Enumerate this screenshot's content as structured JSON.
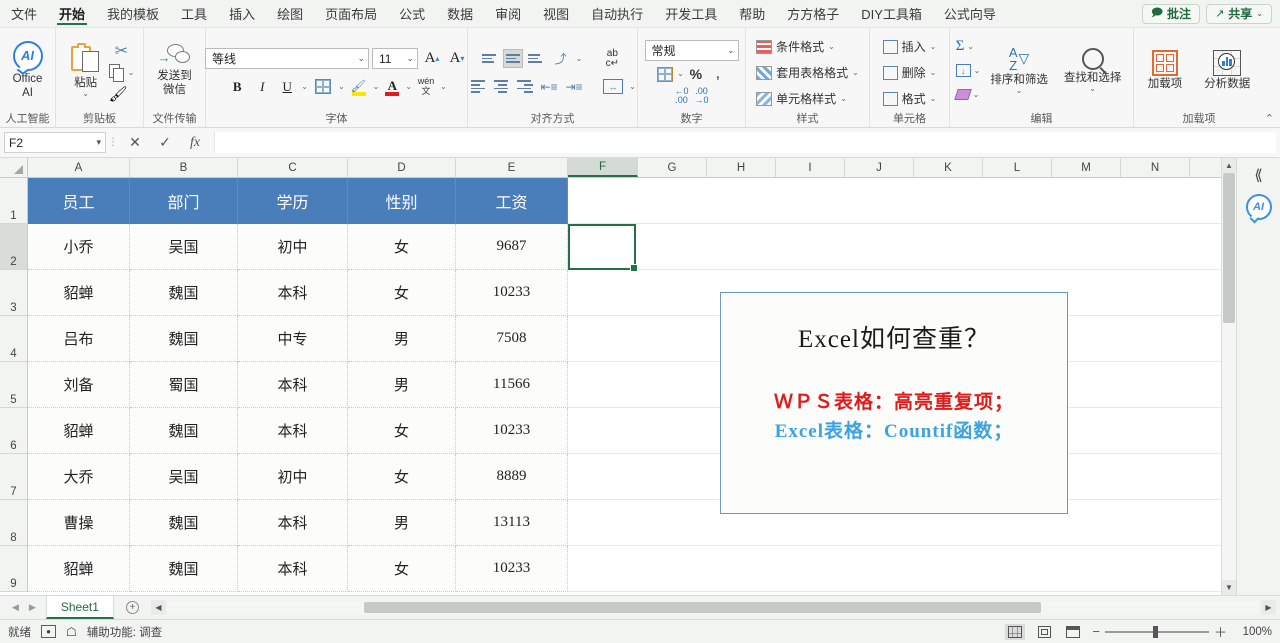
{
  "menu": {
    "tabs": [
      {
        "label": "文件",
        "active": false
      },
      {
        "label": "开始",
        "active": true
      },
      {
        "label": "我的模板",
        "active": false
      },
      {
        "label": "工具",
        "active": false
      },
      {
        "label": "插入",
        "active": false
      },
      {
        "label": "绘图",
        "active": false
      },
      {
        "label": "页面布局",
        "active": false
      },
      {
        "label": "公式",
        "active": false
      },
      {
        "label": "数据",
        "active": false
      },
      {
        "label": "审阅",
        "active": false
      },
      {
        "label": "视图",
        "active": false
      },
      {
        "label": "自动执行",
        "active": false
      },
      {
        "label": "开发工具",
        "active": false
      },
      {
        "label": "帮助",
        "active": false
      },
      {
        "label": "方方格子",
        "active": false
      },
      {
        "label": "DIY工具箱",
        "active": false
      },
      {
        "label": "公式向导",
        "active": false
      }
    ],
    "comment_button": "批注",
    "share_button": "共享"
  },
  "ribbon": {
    "ai_group": {
      "label": "人工智能",
      "button": "Office AI",
      "icon_text": "AI"
    },
    "clipboard_group": {
      "label": "剪贴板",
      "paste": "粘贴"
    },
    "filetransfer_group": {
      "label": "文件传输",
      "send": "发送到微信"
    },
    "font_group": {
      "label": "字体",
      "font_name": "等线",
      "font_size": "11"
    },
    "align_group": {
      "label": "对齐方式"
    },
    "number_group": {
      "label": "数字",
      "format": "常规"
    },
    "styles_group": {
      "label": "样式",
      "items": [
        "条件格式",
        "套用表格格式",
        "单元格样式"
      ]
    },
    "cells_group": {
      "label": "单元格",
      "items": [
        "插入",
        "删除",
        "格式"
      ]
    },
    "editing_group": {
      "label": "编辑",
      "sort_filter": "排序和筛选",
      "find_select": "查找和选择"
    },
    "addins_group": {
      "label": "加载项",
      "addin": "加载项",
      "analyze": "分析数据"
    }
  },
  "formula_bar": {
    "name_box": "F2",
    "formula_value": "",
    "cancel_icon": "✕",
    "confirm_icon": "✓",
    "function_icon": "fx"
  },
  "grid": {
    "columns": [
      "A",
      "B",
      "C",
      "D",
      "E",
      "F",
      "G",
      "H",
      "I",
      "J",
      "K",
      "L",
      "M",
      "N"
    ],
    "selected_column": "F",
    "rows": [
      "1",
      "2",
      "3",
      "4",
      "5",
      "6",
      "7",
      "8",
      "9"
    ],
    "selected_row": "2",
    "header_color": "#4a7ebb",
    "headers": [
      "员工",
      "部门",
      "学历",
      "性别",
      "工资"
    ],
    "data": [
      [
        "小乔",
        "吴国",
        "初中",
        "女",
        "9687"
      ],
      [
        "貂蝉",
        "魏国",
        "本科",
        "女",
        "10233"
      ],
      [
        "吕布",
        "魏国",
        "中专",
        "男",
        "7508"
      ],
      [
        "刘备",
        "蜀国",
        "本科",
        "男",
        "11566"
      ],
      [
        "貂蝉",
        "魏国",
        "本科",
        "女",
        "10233"
      ],
      [
        "大乔",
        "吴国",
        "初中",
        "女",
        "8889"
      ],
      [
        "曹操",
        "魏国",
        "本科",
        "男",
        "13113"
      ],
      [
        "貂蝉",
        "魏国",
        "本科",
        "女",
        "10233"
      ]
    ]
  },
  "textbox": {
    "title": "Excel如何查重？",
    "line1": "ＷＰＳ表格：高亮重复项；",
    "line2": "Excel表格：Countif函数；",
    "line1_color": "#e01b1b",
    "line2_color": "#3aa3e0",
    "border_color": "#6f97c4"
  },
  "sidepanel": {
    "collapse_icon": "⟪",
    "ai_icon": "AI"
  },
  "sheetbar": {
    "tab": "Sheet1",
    "add_label": "+"
  },
  "statusbar": {
    "status": "就绪",
    "accessibility": "辅助功能: 调查",
    "zoom": "100%"
  }
}
